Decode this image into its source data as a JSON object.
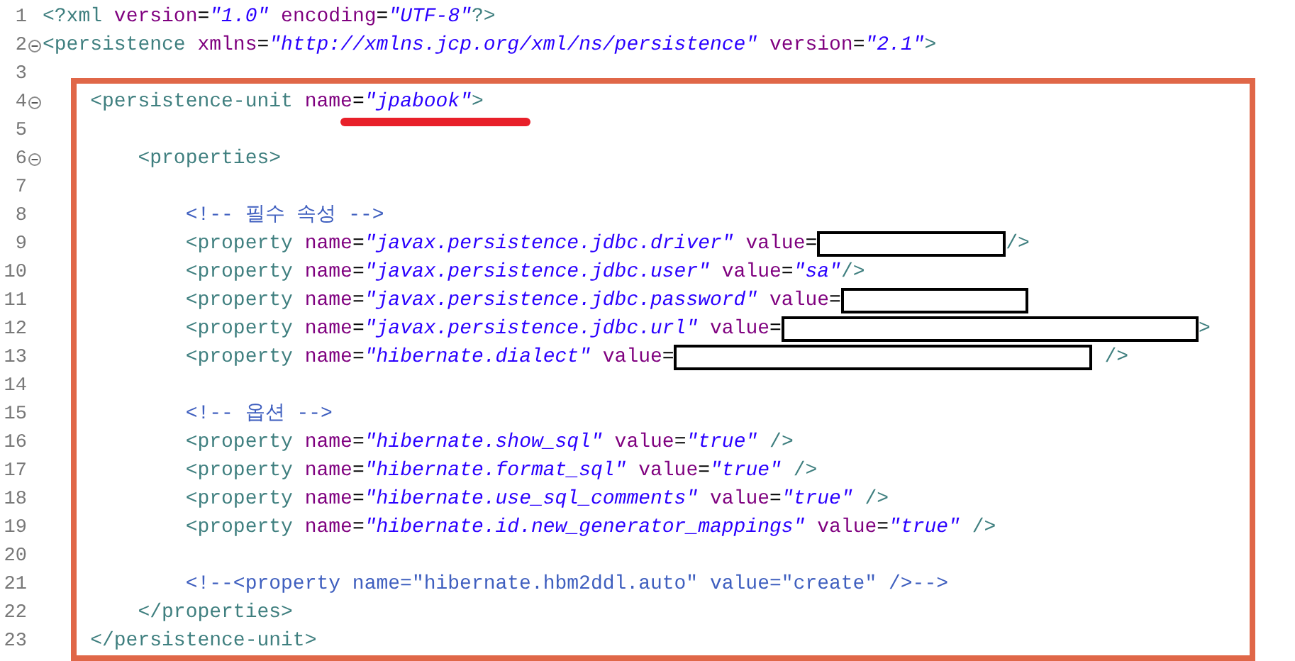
{
  "editor": {
    "lines": [
      {
        "number": "1",
        "fold": false,
        "framed": false,
        "tokens": [
          {
            "kind": "tag",
            "text": "<?xml"
          },
          {
            "kind": "attr",
            "text": " version"
          },
          {
            "kind": "plain",
            "text": "="
          },
          {
            "kind": "string",
            "text": "\"1.0\""
          },
          {
            "kind": "attr",
            "text": " encoding"
          },
          {
            "kind": "plain",
            "text": "="
          },
          {
            "kind": "string",
            "text": "\"UTF-8\""
          },
          {
            "kind": "tag",
            "text": "?>"
          }
        ]
      },
      {
        "number": "2",
        "fold": true,
        "framed": false,
        "tokens": [
          {
            "kind": "tag",
            "text": "<persistence"
          },
          {
            "kind": "attr",
            "text": " xmlns"
          },
          {
            "kind": "plain",
            "text": "="
          },
          {
            "kind": "string",
            "text": "\"http://xmlns.jcp.org/xml/ns/persistence\""
          },
          {
            "kind": "attr",
            "text": " version"
          },
          {
            "kind": "plain",
            "text": "="
          },
          {
            "kind": "string",
            "text": "\"2.1\""
          },
          {
            "kind": "tag",
            "text": ">"
          }
        ]
      },
      {
        "number": "3",
        "fold": false,
        "framed": false
      },
      {
        "number": "4",
        "fold": true,
        "framed": true,
        "tokens": [
          {
            "kind": "tag",
            "text": "    <persistence-unit"
          },
          {
            "kind": "attr",
            "text": " name"
          },
          {
            "kind": "plain",
            "text": "="
          },
          {
            "kind": "string",
            "text": "\"jpabook\"",
            "underlined": true
          },
          {
            "kind": "tag",
            "text": ">"
          }
        ]
      },
      {
        "number": "5",
        "fold": false,
        "framed": true
      },
      {
        "number": "6",
        "fold": true,
        "framed": true,
        "tokens": [
          {
            "kind": "tag",
            "text": "        <properties>"
          }
        ]
      },
      {
        "number": "7",
        "fold": false,
        "framed": true
      },
      {
        "number": "8",
        "fold": false,
        "framed": true,
        "tokens": [
          {
            "kind": "comment",
            "text": "            <!-- 필수 속성 -->"
          }
        ]
      },
      {
        "number": "9",
        "fold": false,
        "framed": true,
        "tokens": [
          {
            "kind": "tag",
            "text": "            <property"
          },
          {
            "kind": "attr",
            "text": " name"
          },
          {
            "kind": "plain",
            "text": "="
          },
          {
            "kind": "string",
            "text": "\"javax.persistence.jdbc.driver\""
          },
          {
            "kind": "attr",
            "text": " value"
          },
          {
            "kind": "plain",
            "text": "="
          },
          {
            "kind": "redacted"
          },
          {
            "kind": "tag",
            "text": "/>"
          }
        ]
      },
      {
        "number": "10",
        "fold": false,
        "framed": true,
        "tokens": [
          {
            "kind": "tag",
            "text": "            <property"
          },
          {
            "kind": "attr",
            "text": " name"
          },
          {
            "kind": "plain",
            "text": "="
          },
          {
            "kind": "string",
            "text": "\"javax.persistence.jdbc.user\""
          },
          {
            "kind": "attr",
            "text": " value"
          },
          {
            "kind": "plain",
            "text": "="
          },
          {
            "kind": "string",
            "text": "\"sa\""
          },
          {
            "kind": "tag",
            "text": "/>"
          }
        ]
      },
      {
        "number": "11",
        "fold": false,
        "framed": true,
        "tokens": [
          {
            "kind": "tag",
            "text": "            <property"
          },
          {
            "kind": "attr",
            "text": " name"
          },
          {
            "kind": "plain",
            "text": "="
          },
          {
            "kind": "string",
            "text": "\"javax.persistence.jdbc.password\""
          },
          {
            "kind": "attr",
            "text": " value"
          },
          {
            "kind": "plain",
            "text": "="
          },
          {
            "kind": "redacted"
          }
        ]
      },
      {
        "number": "12",
        "fold": false,
        "framed": true,
        "tokens": [
          {
            "kind": "tag",
            "text": "            <property"
          },
          {
            "kind": "attr",
            "text": " name"
          },
          {
            "kind": "plain",
            "text": "="
          },
          {
            "kind": "string",
            "text": "\"javax.persistence.jdbc.url\""
          },
          {
            "kind": "attr",
            "text": " value"
          },
          {
            "kind": "plain",
            "text": "="
          },
          {
            "kind": "redacted"
          },
          {
            "kind": "tag",
            "text": ">"
          }
        ]
      },
      {
        "number": "13",
        "fold": false,
        "framed": true,
        "tokens": [
          {
            "kind": "tag",
            "text": "            <property"
          },
          {
            "kind": "attr",
            "text": " name"
          },
          {
            "kind": "plain",
            "text": "="
          },
          {
            "kind": "string",
            "text": "\"hibernate.dialect\""
          },
          {
            "kind": "attr",
            "text": " value"
          },
          {
            "kind": "plain",
            "text": "="
          },
          {
            "kind": "redacted"
          },
          {
            "kind": "tag",
            "text": " />"
          }
        ]
      },
      {
        "number": "14",
        "fold": false,
        "framed": true
      },
      {
        "number": "15",
        "fold": false,
        "framed": true,
        "tokens": [
          {
            "kind": "comment",
            "text": "            <!-- 옵션 -->"
          }
        ]
      },
      {
        "number": "16",
        "fold": false,
        "framed": true,
        "tokens": [
          {
            "kind": "tag",
            "text": "            <property"
          },
          {
            "kind": "attr",
            "text": " name"
          },
          {
            "kind": "plain",
            "text": "="
          },
          {
            "kind": "string",
            "text": "\"hibernate.show_sql\""
          },
          {
            "kind": "attr",
            "text": " value"
          },
          {
            "kind": "plain",
            "text": "="
          },
          {
            "kind": "string",
            "text": "\"true\""
          },
          {
            "kind": "tag",
            "text": " />"
          }
        ]
      },
      {
        "number": "17",
        "fold": false,
        "framed": true,
        "tokens": [
          {
            "kind": "tag",
            "text": "            <property"
          },
          {
            "kind": "attr",
            "text": " name"
          },
          {
            "kind": "plain",
            "text": "="
          },
          {
            "kind": "string",
            "text": "\"hibernate.format_sql\""
          },
          {
            "kind": "attr",
            "text": " value"
          },
          {
            "kind": "plain",
            "text": "="
          },
          {
            "kind": "string",
            "text": "\"true\""
          },
          {
            "kind": "tag",
            "text": " />"
          }
        ]
      },
      {
        "number": "18",
        "fold": false,
        "framed": true,
        "tokens": [
          {
            "kind": "tag",
            "text": "            <property"
          },
          {
            "kind": "attr",
            "text": " name"
          },
          {
            "kind": "plain",
            "text": "="
          },
          {
            "kind": "string",
            "text": "\"hibernate.use_sql_comments\""
          },
          {
            "kind": "attr",
            "text": " value"
          },
          {
            "kind": "plain",
            "text": "="
          },
          {
            "kind": "string",
            "text": "\"true\""
          },
          {
            "kind": "tag",
            "text": " />"
          }
        ]
      },
      {
        "number": "19",
        "fold": false,
        "framed": true,
        "tokens": [
          {
            "kind": "tag",
            "text": "            <property"
          },
          {
            "kind": "attr",
            "text": " name"
          },
          {
            "kind": "plain",
            "text": "="
          },
          {
            "kind": "string",
            "text": "\"hibernate.id.new_generator_mappings\""
          },
          {
            "kind": "attr",
            "text": " value"
          },
          {
            "kind": "plain",
            "text": "="
          },
          {
            "kind": "string",
            "text": "\"true\""
          },
          {
            "kind": "tag",
            "text": " />"
          }
        ]
      },
      {
        "number": "20",
        "fold": false,
        "framed": true
      },
      {
        "number": "21",
        "fold": false,
        "framed": true,
        "tokens": [
          {
            "kind": "comment",
            "text": "            <!--<property name=\"hibernate.hbm2ddl.auto\" value=\"create\" />-->"
          }
        ]
      },
      {
        "number": "22",
        "fold": false,
        "framed": true,
        "tokens": [
          {
            "kind": "tag",
            "text": "        </properties>"
          }
        ]
      },
      {
        "number": "23",
        "fold": false,
        "framed": true,
        "tokens": [
          {
            "kind": "tag",
            "text": "    </persistence-unit>"
          }
        ]
      }
    ]
  }
}
